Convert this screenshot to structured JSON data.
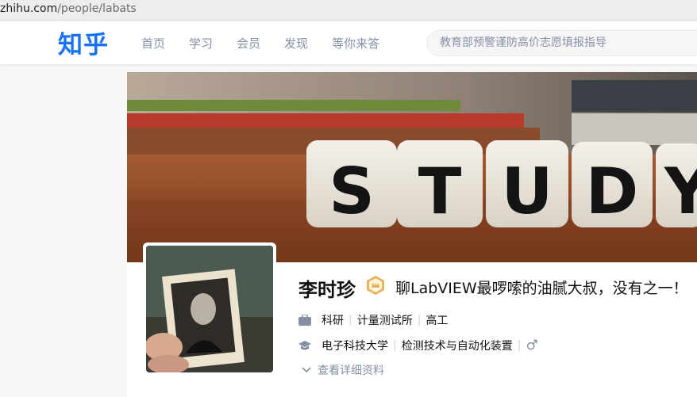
{
  "browser": {
    "url_host": "zhihu.com",
    "url_path": "/people/labats"
  },
  "header": {
    "logo": "知乎",
    "nav": [
      "首页",
      "学习",
      "会员",
      "发现",
      "等你来答"
    ],
    "search_placeholder": "教育部预警谨防高价志愿填报指导"
  },
  "profile": {
    "name": "李时珍",
    "headline": "聊LabVIEW最啰嗦的油腻大叔，没有之一！",
    "cover_text": "STUDY",
    "industry": "科研",
    "company": "计量测试所",
    "title": "高工",
    "school": "电子科技大学",
    "major": "检测技术与自动化装置",
    "gender_symbol": "♂",
    "more_link": "查看详细资料"
  },
  "colors": {
    "brand": "#1772f6",
    "badge": "#e6b35a",
    "muted": "#8590a6"
  }
}
